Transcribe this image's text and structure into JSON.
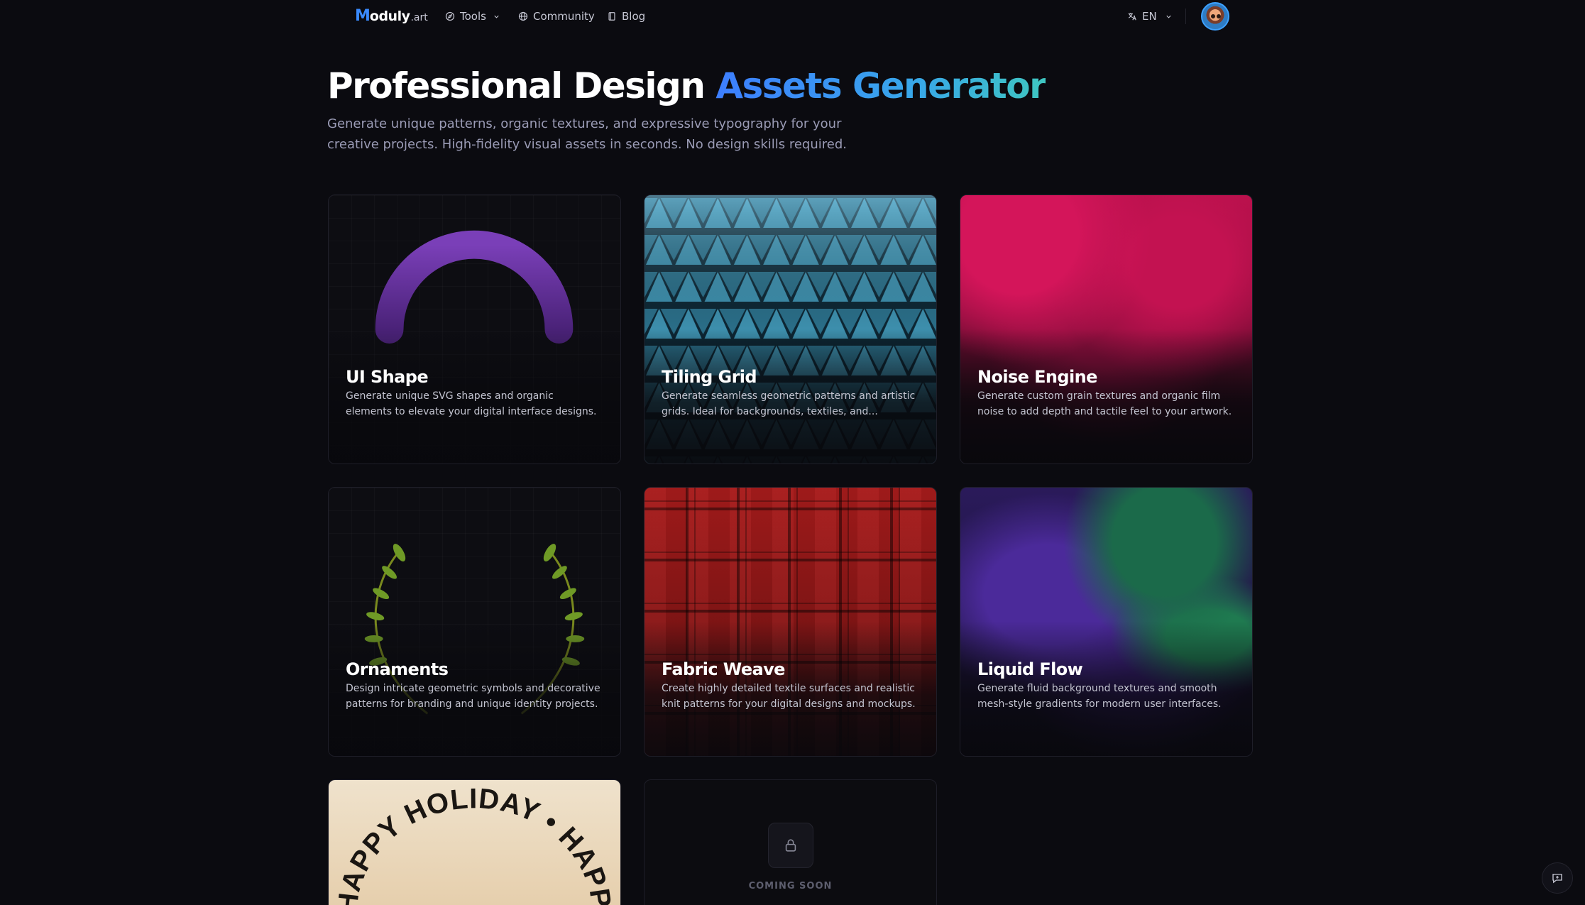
{
  "nav": {
    "logo_mark": "M",
    "logo_rest": "oduly",
    "logo_tld": ".art",
    "tools_label": "Tools",
    "community_label": "Community",
    "blog_label": "Blog",
    "lang_label": "EN"
  },
  "hero": {
    "title_main": "Professional Design ",
    "title_accent": "Assets Generator",
    "subtitle": "Generate unique patterns, organic textures, and expressive typography for your creative projects. High-fidelity visual assets in seconds. No design skills required."
  },
  "cards": [
    {
      "title": "UI Shape",
      "desc": "Generate unique SVG shapes and organic elements to elevate your digital interface designs."
    },
    {
      "title": "Tiling Grid",
      "desc": "Generate seamless geometric patterns and artistic grids. Ideal for backgrounds, textiles, and..."
    },
    {
      "title": "Noise Engine",
      "desc": "Generate custom grain textures and organic film noise to add depth and tactile feel to your artwork."
    },
    {
      "title": "Ornaments",
      "desc": "Design intricate geometric symbols and decorative patterns for branding and unique identity projects."
    },
    {
      "title": "Fabric Weave",
      "desc": "Create highly detailed textile surfaces and realistic knit patterns for your digital designs and mockups."
    },
    {
      "title": "Liquid Flow",
      "desc": "Generate fluid background textures and smooth mesh-style gradients for modern user interfaces."
    }
  ],
  "holiday_text": "HAPPY HOLIDAY • HAPPY HOLIDAY •",
  "coming_soon": "COMING SOON",
  "colors": {
    "background": "#0b0b10",
    "accent_start": "#3d7eff",
    "accent_end": "#3fc6c1",
    "brand": "#3a8bff"
  },
  "icons": {
    "tools": "compass-icon",
    "community": "globe-icon",
    "blog": "book-icon",
    "lang": "translate-icon",
    "dropdown": "chevron-down-icon",
    "lock": "lock-icon",
    "feedback": "message-plus-icon"
  }
}
